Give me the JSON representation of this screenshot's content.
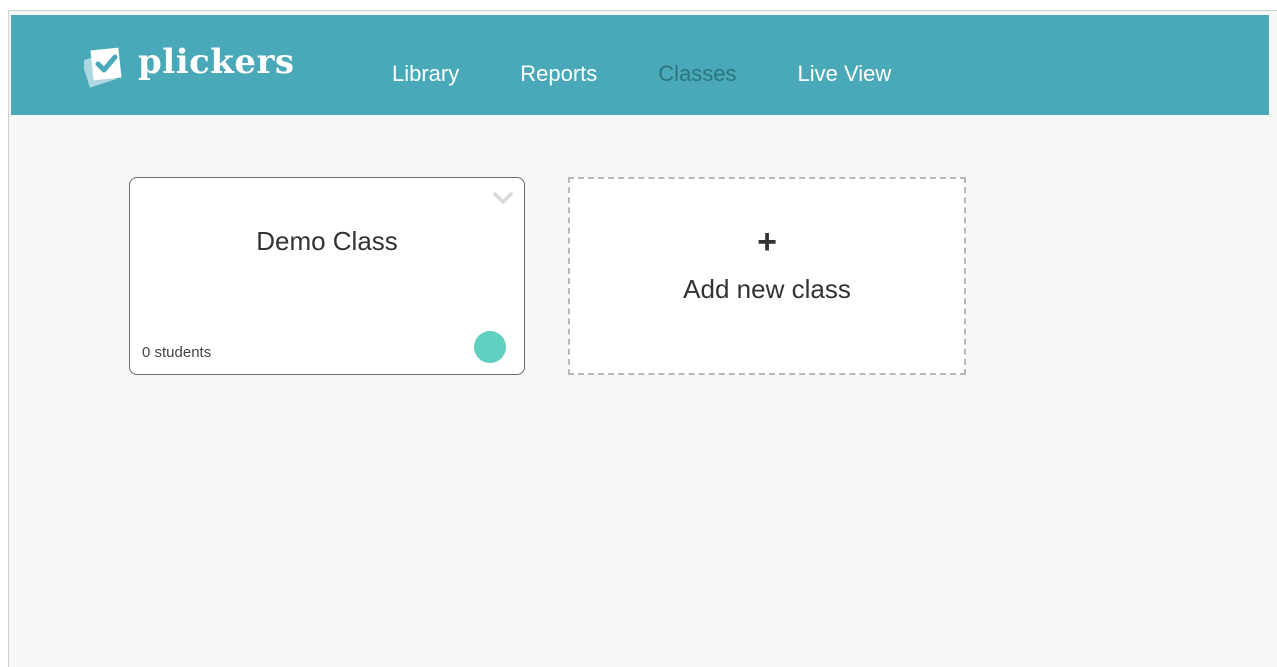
{
  "app": {
    "brand": "plickers",
    "accent_color": "#4aa9b8",
    "active_nav_color": "#2c7580"
  },
  "nav": {
    "items": [
      {
        "label": "Library"
      },
      {
        "label": "Reports"
      },
      {
        "label": "Classes"
      },
      {
        "label": "Live View"
      }
    ],
    "active": "Classes"
  },
  "classes": [
    {
      "name": "Demo Class",
      "student_count": "0 students",
      "color": "#5fcfbf",
      "menu_icon": "chevron-down-icon"
    }
  ],
  "add_class": {
    "icon": "plus-icon",
    "label": "Add new class"
  }
}
